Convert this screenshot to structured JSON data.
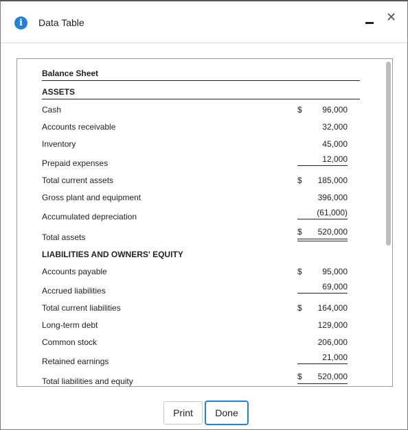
{
  "window": {
    "title": "Data Table"
  },
  "balance_sheet": {
    "heading": "Balance Sheet",
    "assets_heading": "ASSETS",
    "rows": [
      {
        "label": "Cash",
        "currency": "$",
        "amount": "96,000"
      },
      {
        "label": "Accounts receivable",
        "currency": "",
        "amount": "32,000"
      },
      {
        "label": "Inventory",
        "currency": "",
        "amount": "45,000"
      },
      {
        "label": "Prepaid expenses",
        "currency": "",
        "amount": "12,000"
      },
      {
        "label": "Total current assets",
        "currency": "$",
        "amount": "185,000"
      },
      {
        "label": "Gross plant and equipment",
        "currency": "",
        "amount": "396,000"
      },
      {
        "label": "Accumulated depreciation",
        "currency": "",
        "amount": "(61,000)"
      },
      {
        "label": "Total assets",
        "currency": "$",
        "amount": "520,000"
      }
    ],
    "liabilities_heading": "LIABILITIES AND OWNERS' EQUITY",
    "liability_rows": [
      {
        "label": "Accounts payable",
        "currency": "$",
        "amount": "95,000"
      },
      {
        "label": "Accrued liabilities",
        "currency": "",
        "amount": "69,000"
      },
      {
        "label": "Total current liabilities",
        "currency": "$",
        "amount": "164,000"
      },
      {
        "label": "Long-term debt",
        "currency": "",
        "amount": "129,000"
      },
      {
        "label": "Common stock",
        "currency": "",
        "amount": "206,000"
      },
      {
        "label": "Retained earnings",
        "currency": "",
        "amount": "21,000"
      },
      {
        "label": "Total liabilities and equity",
        "currency": "$",
        "amount": "520,000"
      }
    ]
  },
  "footer": {
    "print_label": "Print",
    "done_label": "Done"
  }
}
